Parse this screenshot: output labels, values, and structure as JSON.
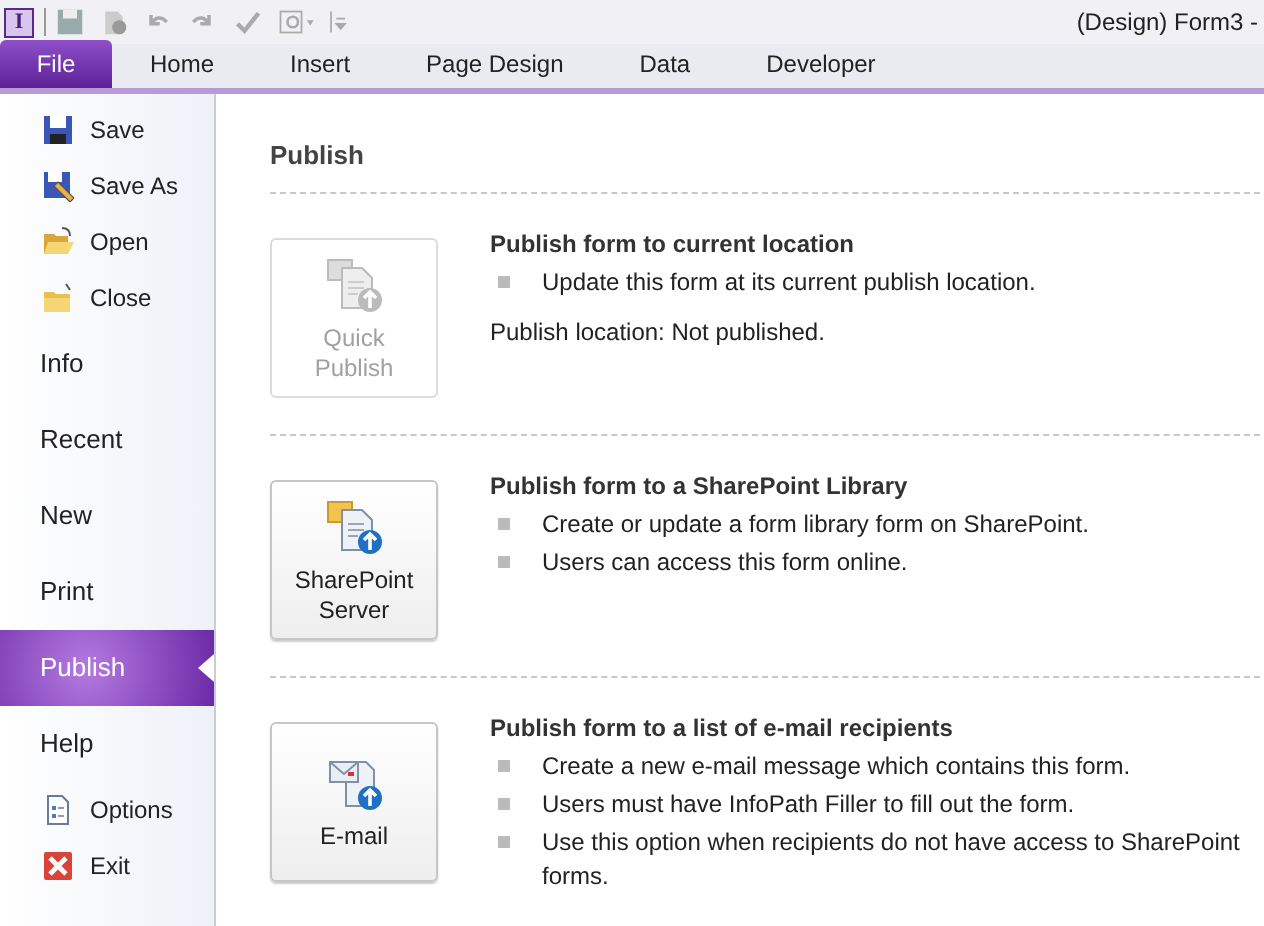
{
  "window": {
    "logo": "I",
    "title": "(Design) Form3 -"
  },
  "tabs": [
    {
      "label": "File",
      "selected": true
    },
    {
      "label": "Home",
      "selected": false
    },
    {
      "label": "Insert",
      "selected": false
    },
    {
      "label": "Page Design",
      "selected": false
    },
    {
      "label": "Data",
      "selected": false
    },
    {
      "label": "Developer",
      "selected": false
    }
  ],
  "sidebar": {
    "items": [
      {
        "kind": "command",
        "label": "Save",
        "selected": false
      },
      {
        "kind": "command",
        "label": "Save As",
        "selected": false
      },
      {
        "kind": "command",
        "label": "Open",
        "selected": false
      },
      {
        "kind": "command",
        "label": "Close",
        "selected": false
      },
      {
        "kind": "page",
        "label": "Info",
        "selected": false
      },
      {
        "kind": "page",
        "label": "Recent",
        "selected": false
      },
      {
        "kind": "page",
        "label": "New",
        "selected": false
      },
      {
        "kind": "page",
        "label": "Print",
        "selected": false
      },
      {
        "kind": "page",
        "label": "Publish",
        "selected": true
      },
      {
        "kind": "page",
        "label": "Help",
        "selected": false
      },
      {
        "kind": "command",
        "label": "Options",
        "selected": false
      },
      {
        "kind": "command",
        "label": "Exit",
        "selected": false
      }
    ]
  },
  "heading": "Publish",
  "sections": [
    {
      "button": [
        "Quick",
        "Publish"
      ],
      "disabled": true,
      "title": "Publish form to current location",
      "bullets": [
        "Update this form at its current publish location."
      ],
      "note": "Publish location: Not published."
    },
    {
      "button": [
        "SharePoint",
        "Server"
      ],
      "disabled": false,
      "title": "Publish form to a SharePoint Library",
      "bullets": [
        "Create or update a form library form on SharePoint.",
        "Users can access this form online."
      ]
    },
    {
      "button": [
        "E-mail"
      ],
      "disabled": false,
      "title": "Publish form to a list of e-mail recipients",
      "bullets": [
        "Create a new e-mail message which contains this form.",
        "Users must have InfoPath Filler to fill out the form.",
        "Use this option when recipients do not have access to SharePoint forms."
      ]
    }
  ]
}
